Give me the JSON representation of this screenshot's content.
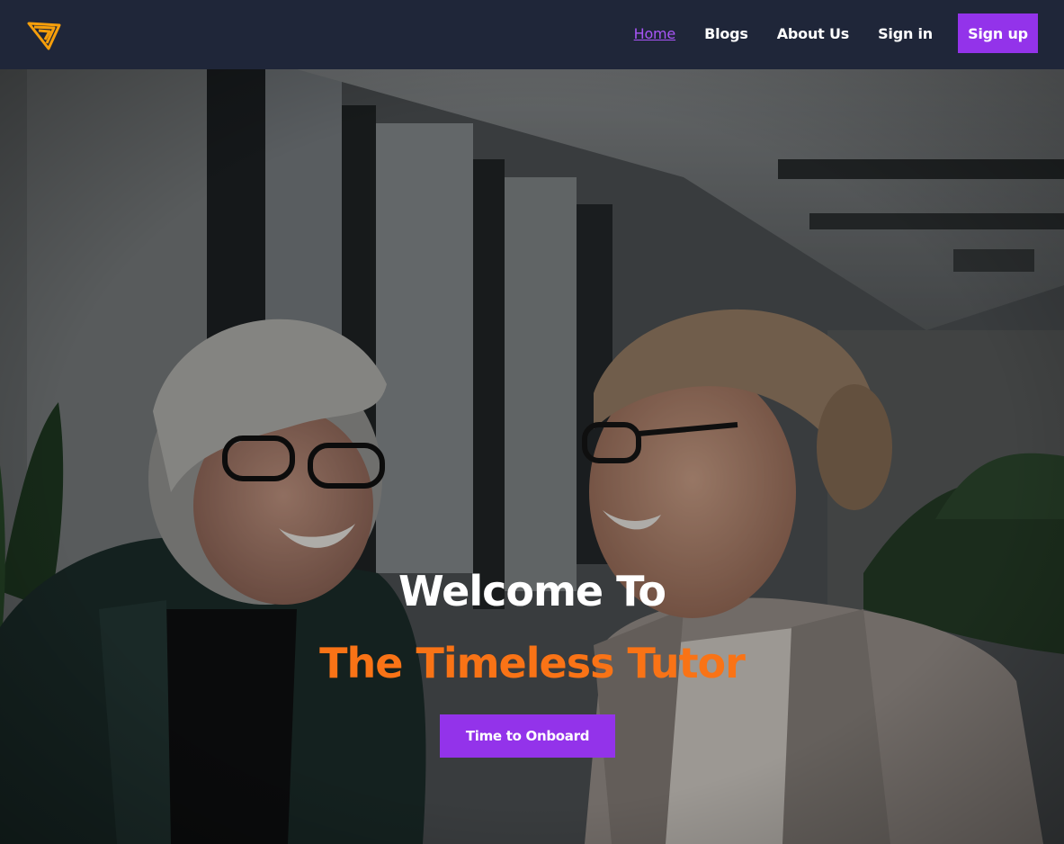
{
  "nav": {
    "logo_icon": "triangle-logo-icon",
    "links": [
      {
        "label": "Home",
        "active": true
      },
      {
        "label": "Blogs"
      },
      {
        "label": "About Us"
      },
      {
        "label": "Sign in"
      }
    ],
    "signup_label": "Sign up"
  },
  "hero": {
    "welcome": "Welcome To",
    "brand": "The Timeless Tutor",
    "cta_label": "Time to Onboard"
  },
  "colors": {
    "navbar": "#1f2639",
    "accent": "#9333ea",
    "brand_orange": "#f97316",
    "active_link": "#a855f7",
    "logo": "#f59e0b"
  }
}
